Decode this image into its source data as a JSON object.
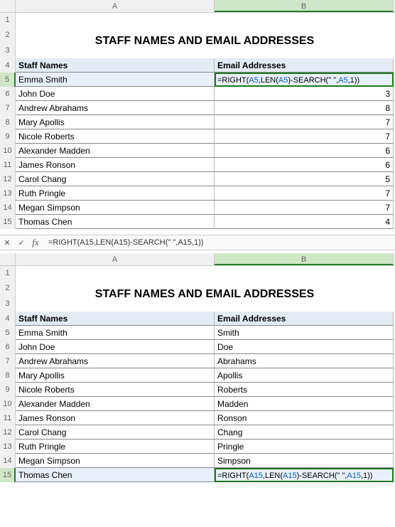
{
  "columns": [
    "A",
    "B"
  ],
  "title": "STAFF NAMES AND EMAIL ADDRESSES",
  "headers": {
    "A": "Staff Names",
    "B": "Email Addresses"
  },
  "formula_bar": {
    "cancel": "✕",
    "accept": "✓",
    "fx": "fx",
    "text": "=RIGHT(A15,LEN(A15)-SEARCH(\" \",A15,1))"
  },
  "sheet1": {
    "selected_row": 5,
    "rows": [
      {
        "n": 5,
        "A": "Emma Smith",
        "B_formula": {
          "pre": "=RIGHT(",
          "r1": "A5",
          "mid1": ",LEN(",
          "r2": "A5",
          "mid2": ")-SEARCH(\" \",",
          "r3": "A5",
          "mid3": ",1))"
        }
      },
      {
        "n": 6,
        "A": "John Doe",
        "B": "3"
      },
      {
        "n": 7,
        "A": "Andrew Abrahams",
        "B": "8"
      },
      {
        "n": 8,
        "A": "Mary Apollis",
        "B": "7"
      },
      {
        "n": 9,
        "A": "Nicole Roberts",
        "B": "7"
      },
      {
        "n": 10,
        "A": "Alexander Madden",
        "B": "6"
      },
      {
        "n": 11,
        "A": "James Ronson",
        "B": "6"
      },
      {
        "n": 12,
        "A": "Carol Chang",
        "B": "5"
      },
      {
        "n": 13,
        "A": "Ruth Pringle",
        "B": "7"
      },
      {
        "n": 14,
        "A": "Megan Simpson",
        "B": "7"
      },
      {
        "n": 15,
        "A": "Thomas Chen",
        "B": "4"
      }
    ]
  },
  "sheet2": {
    "selected_row": 15,
    "rows": [
      {
        "n": 5,
        "A": "Emma Smith",
        "B": "Smith"
      },
      {
        "n": 6,
        "A": "John Doe",
        "B": "Doe"
      },
      {
        "n": 7,
        "A": "Andrew Abrahams",
        "B": "Abrahams"
      },
      {
        "n": 8,
        "A": "Mary Apollis",
        "B": "Apollis"
      },
      {
        "n": 9,
        "A": "Nicole Roberts",
        "B": "Roberts"
      },
      {
        "n": 10,
        "A": "Alexander Madden",
        "B": "Madden"
      },
      {
        "n": 11,
        "A": "James Ronson",
        "B": "Ronson"
      },
      {
        "n": 12,
        "A": "Carol Chang",
        "B": "Chang"
      },
      {
        "n": 13,
        "A": "Ruth Pringle",
        "B": "Pringle"
      },
      {
        "n": 14,
        "A": "Megan Simpson",
        "B": "Simpson"
      },
      {
        "n": 15,
        "A": "Thomas Chen",
        "B_formula": {
          "pre": "=RIGHT(",
          "r1": "A15",
          "mid1": ",LEN(",
          "r2": "A15",
          "mid2": ")-SEARCH(\" \",",
          "r3": "A15",
          "mid3": ",1))"
        }
      }
    ]
  }
}
